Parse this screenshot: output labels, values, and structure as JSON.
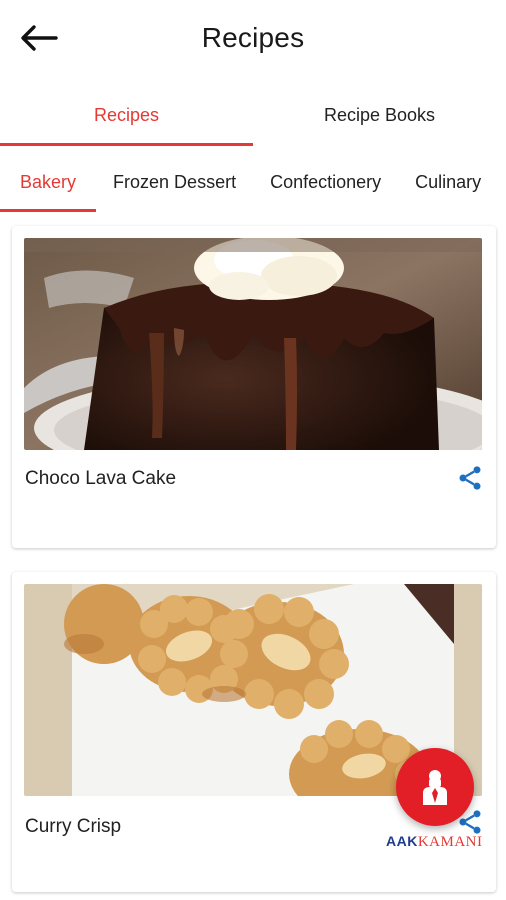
{
  "header": {
    "title": "Recipes",
    "back_icon": "arrow-left-icon"
  },
  "tabs": [
    {
      "label": "Recipes",
      "active": true
    },
    {
      "label": "Recipe Books",
      "active": false
    }
  ],
  "categories": [
    {
      "label": "Bakery",
      "active": true
    },
    {
      "label": "Frozen Dessert",
      "active": false
    },
    {
      "label": "Confectionery",
      "active": false
    },
    {
      "label": "Culinary",
      "active": false
    }
  ],
  "recipes": [
    {
      "title": "Choco Lava Cake",
      "image": "choco-lava-cake-photo",
      "share_icon": "share-icon"
    },
    {
      "title": "Curry Crisp",
      "image": "curry-crisp-photo",
      "share_icon": "share-icon"
    }
  ],
  "logo": {
    "part1": "AAK",
    "part2": "KAMANI"
  },
  "fab": {
    "icon": "chef-icon"
  },
  "colors": {
    "accent": "#e53935",
    "fab": "#e21f26",
    "share": "#1f6fc0",
    "logo_blue": "#1e3c8c"
  }
}
